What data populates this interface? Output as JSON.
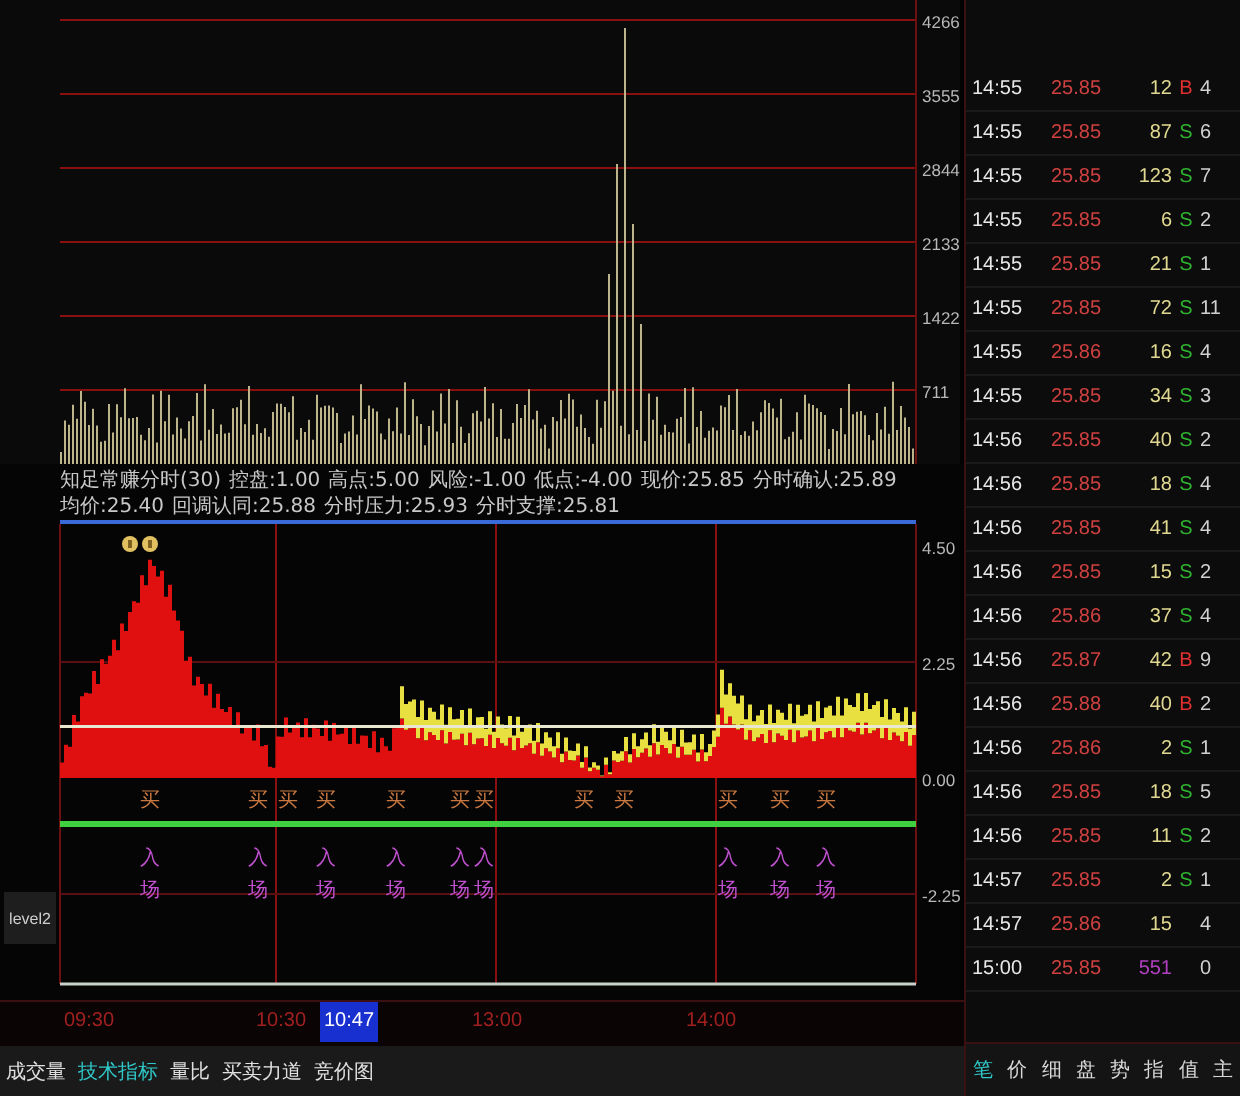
{
  "volume_axis": [
    "4266",
    "3555",
    "2844",
    "2133",
    "1422",
    "711"
  ],
  "info_line": [
    "知足常赚分时(30)",
    "控盘:1.00",
    "高点:5.00",
    "风险:-1.00",
    "低点:-4.00",
    "现价:25.85",
    "分时确认:25.89",
    "均价:25.40",
    "回调认同:25.88",
    "分时压力:25.93",
    "分时支撑:25.81"
  ],
  "indicator_axis": [
    "4.50",
    "2.25",
    "0.00",
    "-2.25"
  ],
  "side_label": "level2",
  "signals": [
    {
      "top": "买",
      "entry": [
        "入",
        "场"
      ]
    },
    {
      "top": "买",
      "entry": [
        "入",
        "场"
      ]
    },
    {
      "top": "买"
    },
    {
      "top": "买",
      "entry": [
        "入",
        "场"
      ]
    },
    {
      "top": "买",
      "entry": [
        "入",
        "场"
      ]
    },
    {
      "top": "买",
      "entry": [
        "入",
        "场"
      ]
    },
    {
      "top": "买",
      "entry": [
        "入",
        "场"
      ]
    },
    {
      "top": "买"
    },
    {
      "top": "买"
    },
    {
      "top": "买",
      "entry": [
        "入",
        "场"
      ]
    },
    {
      "top": "买",
      "entry": [
        "入",
        "场"
      ]
    },
    {
      "top": "买",
      "entry": [
        "入",
        "场"
      ]
    }
  ],
  "time_axis": [
    "09:30",
    "10:30",
    "13:00",
    "14:00"
  ],
  "cursor_time": "10:47",
  "bottom_tabs": [
    {
      "label": "成交量",
      "selected": false
    },
    {
      "label": "技术指标",
      "selected": true
    },
    {
      "label": "量比",
      "selected": false
    },
    {
      "label": "买卖力道",
      "selected": false
    },
    {
      "label": "竞价图",
      "selected": false
    }
  ],
  "ticks": [
    {
      "time": "14:55",
      "price": "25.85",
      "volume": "12",
      "side": "B",
      "buy": true,
      "count": "4",
      "large": false
    },
    {
      "time": "14:55",
      "price": "25.85",
      "volume": "87",
      "side": "S",
      "buy": false,
      "count": "6",
      "large": false
    },
    {
      "time": "14:55",
      "price": "25.85",
      "volume": "123",
      "side": "S",
      "buy": false,
      "count": "7",
      "large": false
    },
    {
      "time": "14:55",
      "price": "25.85",
      "volume": "6",
      "side": "S",
      "buy": false,
      "count": "2",
      "large": false
    },
    {
      "time": "14:55",
      "price": "25.85",
      "volume": "21",
      "side": "S",
      "buy": false,
      "count": "1",
      "large": false
    },
    {
      "time": "14:55",
      "price": "25.85",
      "volume": "72",
      "side": "S",
      "buy": false,
      "count": "11",
      "large": false
    },
    {
      "time": "14:55",
      "price": "25.86",
      "volume": "16",
      "side": "S",
      "buy": false,
      "count": "4",
      "large": false
    },
    {
      "time": "14:55",
      "price": "25.85",
      "volume": "34",
      "side": "S",
      "buy": false,
      "count": "3",
      "large": false
    },
    {
      "time": "14:56",
      "price": "25.85",
      "volume": "40",
      "side": "S",
      "buy": false,
      "count": "2",
      "large": false
    },
    {
      "time": "14:56",
      "price": "25.85",
      "volume": "18",
      "side": "S",
      "buy": false,
      "count": "4",
      "large": false
    },
    {
      "time": "14:56",
      "price": "25.85",
      "volume": "41",
      "side": "S",
      "buy": false,
      "count": "4",
      "large": false
    },
    {
      "time": "14:56",
      "price": "25.85",
      "volume": "15",
      "side": "S",
      "buy": false,
      "count": "2",
      "large": false
    },
    {
      "time": "14:56",
      "price": "25.86",
      "volume": "37",
      "side": "S",
      "buy": false,
      "count": "4",
      "large": false
    },
    {
      "time": "14:56",
      "price": "25.87",
      "volume": "42",
      "side": "B",
      "buy": true,
      "count": "9",
      "large": false
    },
    {
      "time": "14:56",
      "price": "25.88",
      "volume": "40",
      "side": "B",
      "buy": true,
      "count": "2",
      "large": false
    },
    {
      "time": "14:56",
      "price": "25.86",
      "volume": "2",
      "side": "S",
      "buy": false,
      "count": "1",
      "large": false
    },
    {
      "time": "14:56",
      "price": "25.85",
      "volume": "18",
      "side": "S",
      "buy": false,
      "count": "5",
      "large": false
    },
    {
      "time": "14:56",
      "price": "25.85",
      "volume": "11",
      "side": "S",
      "buy": false,
      "count": "2",
      "large": false
    },
    {
      "time": "14:57",
      "price": "25.85",
      "volume": "2",
      "side": "S",
      "buy": false,
      "count": "1",
      "large": false
    },
    {
      "time": "14:57",
      "price": "25.86",
      "volume": "15",
      "count": "4",
      "large": false
    },
    {
      "time": "15:00",
      "price": "25.85",
      "volume": "551",
      "count": "0",
      "large": true
    }
  ],
  "side_tabs": [
    {
      "label": "笔",
      "selected": true
    },
    {
      "label": "价",
      "selected": false
    },
    {
      "label": "细",
      "selected": false
    },
    {
      "label": "盘",
      "selected": false
    },
    {
      "label": "势",
      "selected": false
    },
    {
      "label": "指",
      "selected": false
    },
    {
      "label": "值",
      "selected": false
    },
    {
      "label": "主",
      "selected": false
    }
  ]
}
